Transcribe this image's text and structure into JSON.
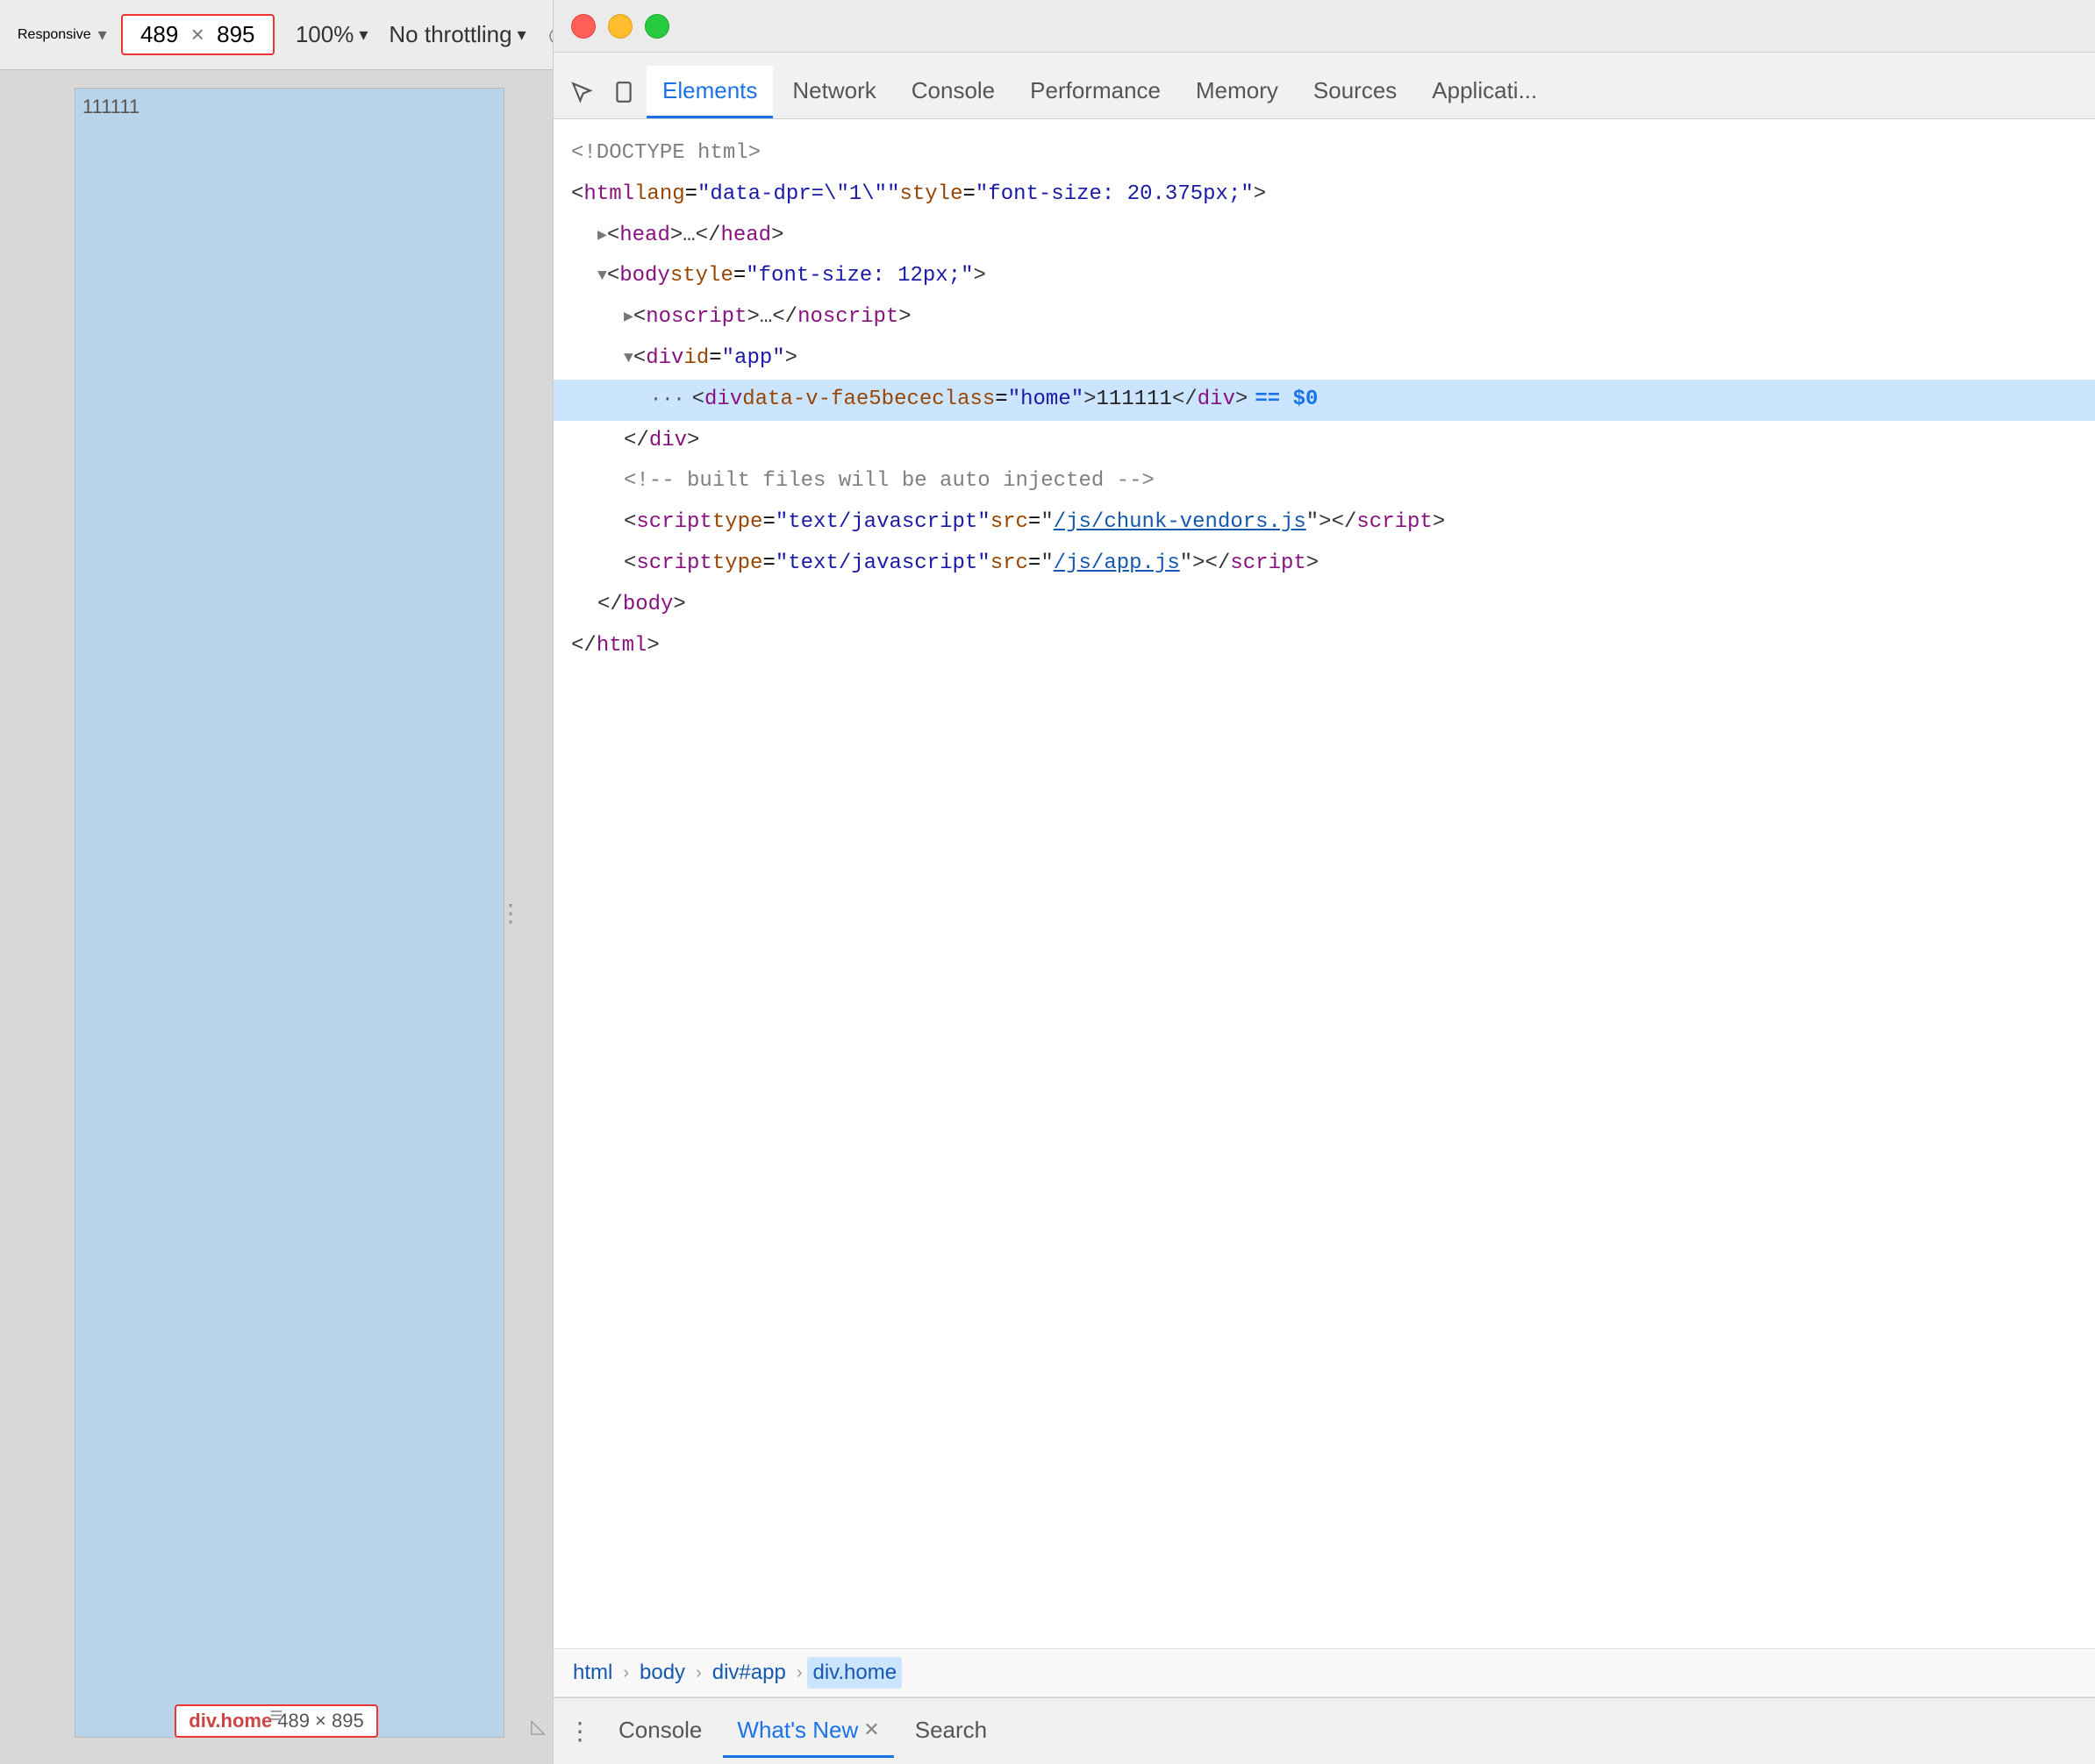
{
  "toolbar": {
    "responsive_label": "Responsive",
    "dropdown_arrow": "▾",
    "width_value": "489",
    "x_separator": "×",
    "height_value": "895",
    "zoom_value": "100%",
    "zoom_arrow": "▾",
    "throttling_label": "No throttling",
    "throttling_arrow": "▾",
    "no_throttle_icon": "⦸"
  },
  "viewport": {
    "content_text": "111111",
    "dim_label_name": "div.home",
    "dim_label_size": "489 × 895"
  },
  "devtools": {
    "tabs": [
      {
        "id": "elements",
        "label": "Elements",
        "active": true
      },
      {
        "id": "network",
        "label": "Network",
        "active": false
      },
      {
        "id": "console-tab",
        "label": "Console",
        "active": false
      },
      {
        "id": "performance",
        "label": "Performance",
        "active": false
      },
      {
        "id": "memory",
        "label": "Memory",
        "active": false
      },
      {
        "id": "sources",
        "label": "Sources",
        "active": false
      },
      {
        "id": "application",
        "label": "Applicati...",
        "active": false
      }
    ],
    "html_lines": [
      {
        "id": "doctype",
        "indent": 0,
        "content": "<!DOCTYPE html>",
        "type": "comment",
        "highlighted": false
      },
      {
        "id": "html-open",
        "indent": 0,
        "highlighted": false,
        "parts": [
          {
            "type": "bracket",
            "text": "<"
          },
          {
            "type": "tag",
            "text": "html"
          },
          {
            "type": "text",
            "text": " "
          },
          {
            "type": "attr-name",
            "text": "lang"
          },
          {
            "type": "text",
            "text": "="
          },
          {
            "type": "attr-val",
            "text": "\"data-dpr=\\\"1\\\"\""
          },
          {
            "type": "text",
            "text": " "
          },
          {
            "type": "attr-name",
            "text": "style"
          },
          {
            "type": "text",
            "text": "="
          },
          {
            "type": "attr-val",
            "text": "\"font-size: 20.375px;\""
          },
          {
            "type": "bracket",
            "text": ">"
          }
        ]
      },
      {
        "id": "head-collapsed",
        "indent": 1,
        "highlighted": false,
        "parts": [
          {
            "type": "triangle",
            "text": "▶"
          },
          {
            "type": "bracket",
            "text": " <"
          },
          {
            "type": "tag",
            "text": "head"
          },
          {
            "type": "bracket",
            "text": ">…</"
          },
          {
            "type": "tag",
            "text": "head"
          },
          {
            "type": "bracket",
            "text": ">"
          }
        ]
      },
      {
        "id": "body-open",
        "indent": 1,
        "highlighted": false,
        "parts": [
          {
            "type": "triangle-open",
            "text": "▼"
          },
          {
            "type": "bracket",
            "text": " <"
          },
          {
            "type": "tag",
            "text": "body"
          },
          {
            "type": "text",
            "text": " "
          },
          {
            "type": "attr-name",
            "text": "style"
          },
          {
            "type": "text",
            "text": "="
          },
          {
            "type": "attr-val",
            "text": "\"font-size: 12px;\""
          },
          {
            "type": "bracket",
            "text": ">"
          }
        ]
      },
      {
        "id": "noscript-collapsed",
        "indent": 2,
        "highlighted": false,
        "parts": [
          {
            "type": "triangle",
            "text": "▶"
          },
          {
            "type": "bracket",
            "text": " <"
          },
          {
            "type": "tag",
            "text": "noscript"
          },
          {
            "type": "bracket",
            "text": ">…</"
          },
          {
            "type": "tag",
            "text": "noscript"
          },
          {
            "type": "bracket",
            "text": ">"
          }
        ]
      },
      {
        "id": "div-app-open",
        "indent": 2,
        "highlighted": false,
        "parts": [
          {
            "type": "triangle-open",
            "text": "▼"
          },
          {
            "type": "bracket",
            "text": " <"
          },
          {
            "type": "tag",
            "text": "div"
          },
          {
            "type": "text",
            "text": " "
          },
          {
            "type": "attr-name",
            "text": "id"
          },
          {
            "type": "text",
            "text": "="
          },
          {
            "type": "attr-val",
            "text": "\"app\""
          },
          {
            "type": "bracket",
            "text": ">"
          }
        ]
      },
      {
        "id": "div-home-selected",
        "indent": 3,
        "highlighted": true,
        "has_dot": true,
        "parts": [
          {
            "type": "bracket",
            "text": "<"
          },
          {
            "type": "tag",
            "text": "div"
          },
          {
            "type": "text",
            "text": " "
          },
          {
            "type": "attr-name",
            "text": "data-v-fae5bece"
          },
          {
            "type": "text",
            "text": " "
          },
          {
            "type": "attr-name",
            "text": "class"
          },
          {
            "type": "text",
            "text": "="
          },
          {
            "type": "attr-val",
            "text": "\"home\""
          },
          {
            "type": "bracket",
            "text": "> "
          },
          {
            "type": "text-content",
            "text": "111111 "
          },
          {
            "type": "bracket",
            "text": "</"
          },
          {
            "type": "tag",
            "text": "div"
          },
          {
            "type": "bracket",
            "text": ">"
          },
          {
            "type": "selected-indicator",
            "text": " == $0"
          }
        ]
      },
      {
        "id": "div-app-close",
        "indent": 2,
        "highlighted": false,
        "parts": [
          {
            "type": "bracket",
            "text": "</"
          },
          {
            "type": "tag",
            "text": "div"
          },
          {
            "type": "bracket",
            "text": ">"
          }
        ]
      },
      {
        "id": "comment-auto-injected",
        "indent": 2,
        "highlighted": false,
        "parts": [
          {
            "type": "comment",
            "text": "<!-- built files will be auto injected -->"
          }
        ]
      },
      {
        "id": "script-vendors",
        "indent": 2,
        "highlighted": false,
        "parts": [
          {
            "type": "bracket",
            "text": "<"
          },
          {
            "type": "tag",
            "text": "script"
          },
          {
            "type": "text",
            "text": " "
          },
          {
            "type": "attr-name",
            "text": "type"
          },
          {
            "type": "text",
            "text": "="
          },
          {
            "type": "attr-val",
            "text": "\"text/javascript\""
          },
          {
            "type": "text",
            "text": " "
          },
          {
            "type": "attr-name",
            "text": "src"
          },
          {
            "type": "text",
            "text": "="
          },
          {
            "type": "bracket",
            "text": "\""
          },
          {
            "type": "link",
            "text": "/js/chunk-vendors.js"
          },
          {
            "type": "bracket",
            "text": "\""
          },
          {
            "type": "bracket",
            "text": "></"
          },
          {
            "type": "tag",
            "text": "script"
          },
          {
            "type": "bracket",
            "text": ">"
          }
        ]
      },
      {
        "id": "script-app",
        "indent": 2,
        "highlighted": false,
        "parts": [
          {
            "type": "bracket",
            "text": "<"
          },
          {
            "type": "tag",
            "text": "script"
          },
          {
            "type": "text",
            "text": " "
          },
          {
            "type": "attr-name",
            "text": "type"
          },
          {
            "type": "text",
            "text": "="
          },
          {
            "type": "attr-val",
            "text": "\"text/javascript\""
          },
          {
            "type": "text",
            "text": " "
          },
          {
            "type": "attr-name",
            "text": "src"
          },
          {
            "type": "text",
            "text": "="
          },
          {
            "type": "bracket",
            "text": "\""
          },
          {
            "type": "link",
            "text": "/js/app.js"
          },
          {
            "type": "bracket",
            "text": "\""
          },
          {
            "type": "bracket",
            "text": "></"
          },
          {
            "type": "tag",
            "text": "script"
          },
          {
            "type": "bracket",
            "text": ">"
          }
        ]
      },
      {
        "id": "body-close",
        "indent": 1,
        "highlighted": false,
        "parts": [
          {
            "type": "bracket",
            "text": "</"
          },
          {
            "type": "tag",
            "text": "body"
          },
          {
            "type": "bracket",
            "text": ">"
          }
        ]
      },
      {
        "id": "html-close",
        "indent": 0,
        "highlighted": false,
        "parts": [
          {
            "type": "bracket",
            "text": "</"
          },
          {
            "type": "tag",
            "text": "html"
          },
          {
            "type": "bracket",
            "text": ">"
          }
        ]
      }
    ],
    "breadcrumb": [
      {
        "id": "bc-html",
        "label": "html",
        "active": false
      },
      {
        "id": "bc-body",
        "label": "body",
        "active": false
      },
      {
        "id": "bc-div-app",
        "label": "div#app",
        "active": false
      },
      {
        "id": "bc-div-home",
        "label": "div.home",
        "active": true
      }
    ],
    "bottom_tabs": [
      {
        "id": "bt-console",
        "label": "Console",
        "active": false,
        "closeable": false
      },
      {
        "id": "bt-whats-new",
        "label": "What's New",
        "active": true,
        "closeable": true
      },
      {
        "id": "bt-search",
        "label": "Search",
        "active": false,
        "closeable": false
      }
    ]
  }
}
